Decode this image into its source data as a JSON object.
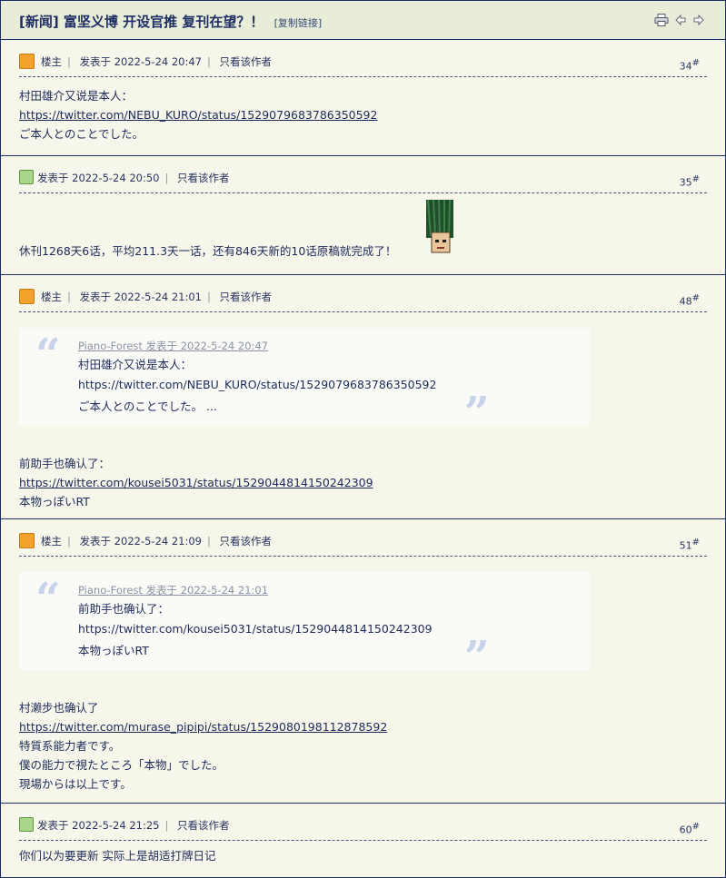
{
  "thread": {
    "title": "[新闻] 富坚义博 开设官推 复刊在望？！",
    "copy_link": "[复制链接]"
  },
  "colors": {
    "border": "#1e2d63",
    "background": "#f6f6ea",
    "quote_mark": "#c7d3ea"
  },
  "posts": [
    {
      "badge": "楼主",
      "posted": "发表于 2022-5-24 20:47",
      "only_author": "只看该作者",
      "floor": "34",
      "lines": [
        "村田雄介又说是本人：",
        "https://twitter.com/NEBU_KURO/status/1529079683786350592",
        "ご本人とのことでした。"
      ]
    },
    {
      "posted": "发表于 2022-5-24 20:50",
      "only_author": "只看该作者",
      "floor": "35",
      "lines": [
        "休刊1268天6话，平均211.3天一话，还有846天新的10话原稿就完成了！"
      ]
    },
    {
      "badge": "楼主",
      "posted": "发表于 2022-5-24 21:01",
      "only_author": "只看该作者",
      "floor": "48",
      "quote": {
        "header": "Piano-Forest 发表于 2022-5-24 20:47",
        "lines": [
          "村田雄介又说是本人：",
          "https://twitter.com/NEBU_KURO/status/1529079683786350592",
          "ご本人とのことでした。 ..."
        ]
      },
      "lines": [
        "前助手也确认了：",
        "https://twitter.com/kousei5031/status/1529044814150242309",
        "本物っぽいRT"
      ]
    },
    {
      "badge": "楼主",
      "posted": "发表于 2022-5-24 21:09",
      "only_author": "只看该作者",
      "floor": "51",
      "quote": {
        "header": "Piano-Forest 发表于 2022-5-24 21:01",
        "lines": [
          "前助手也确认了：",
          "https://twitter.com/kousei5031/status/1529044814150242309",
          "本物っぽいRT"
        ]
      },
      "lines": [
        "村濑步也确认了",
        "https://twitter.com/murase_pipipi/status/1529080198112878592",
        "特質系能力者です。",
        "僕の能力で視たところ「本物」でした。",
        "現場からは以上です。"
      ]
    },
    {
      "posted": "发表于 2022-5-24 21:25",
      "only_author": "只看该作者",
      "floor": "60",
      "lines": [
        "你们以为要更新 实际上是胡适打牌日记"
      ]
    }
  ],
  "quote_marks": {
    "open": "“",
    "close": "”"
  },
  "icons": [
    "print-icon",
    "prev-thread-icon",
    "next-thread-icon",
    "avatar-icon",
    "sticker-image"
  ]
}
